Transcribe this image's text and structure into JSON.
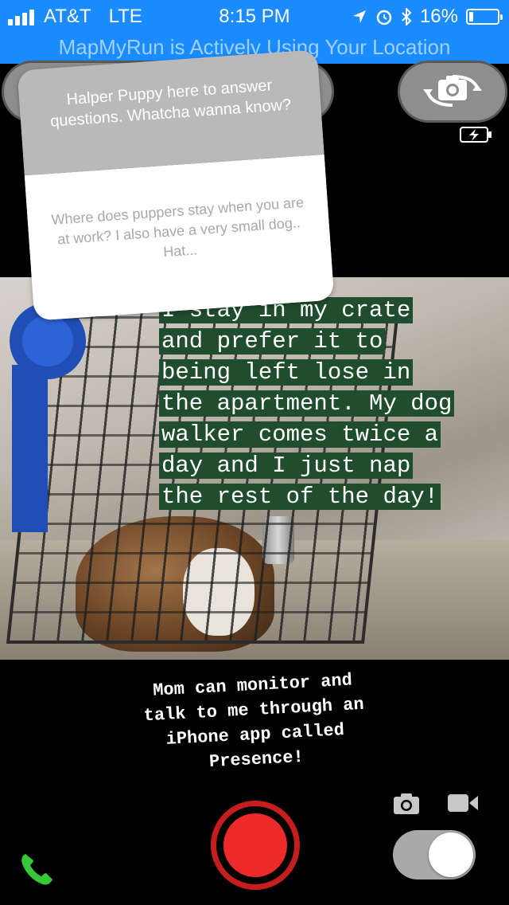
{
  "status_bar": {
    "carrier": "AT&T",
    "network": "LTE",
    "time": "8:15 PM",
    "battery_percent": "16%",
    "battery_level": 0.16,
    "icons": [
      "signal-icon",
      "location-arrow-icon",
      "alarm-icon",
      "bluetooth-icon",
      "battery-icon"
    ]
  },
  "location_banner": {
    "text": "MapMyRun is Actively Using Your Location"
  },
  "question_sticker": {
    "prompt": "Halper Puppy here to answer questions. Whatcha wanna know?",
    "question": "Where does puppers stay when you are at work? I also have a very small dog.. Hat..."
  },
  "photo_caption": {
    "lines": [
      "I stay in my crate",
      "and prefer it to",
      "being left lose in",
      "the apartment. My dog",
      "walker comes twice a",
      "day and I just nap",
      "the rest of the day!"
    ],
    "highlight_color": "#1f4d2e"
  },
  "bottom_caption": {
    "lines": [
      "Mom can monitor and",
      "talk to me through an",
      "iPhone app called",
      "Presence!"
    ]
  },
  "controls": {
    "record_color": "#ee2a2a",
    "icons": [
      "camera-flip-icon",
      "charging-icon",
      "photo-mode-icon",
      "video-mode-icon",
      "record-icon",
      "phone-icon",
      "toggle-switch"
    ]
  }
}
